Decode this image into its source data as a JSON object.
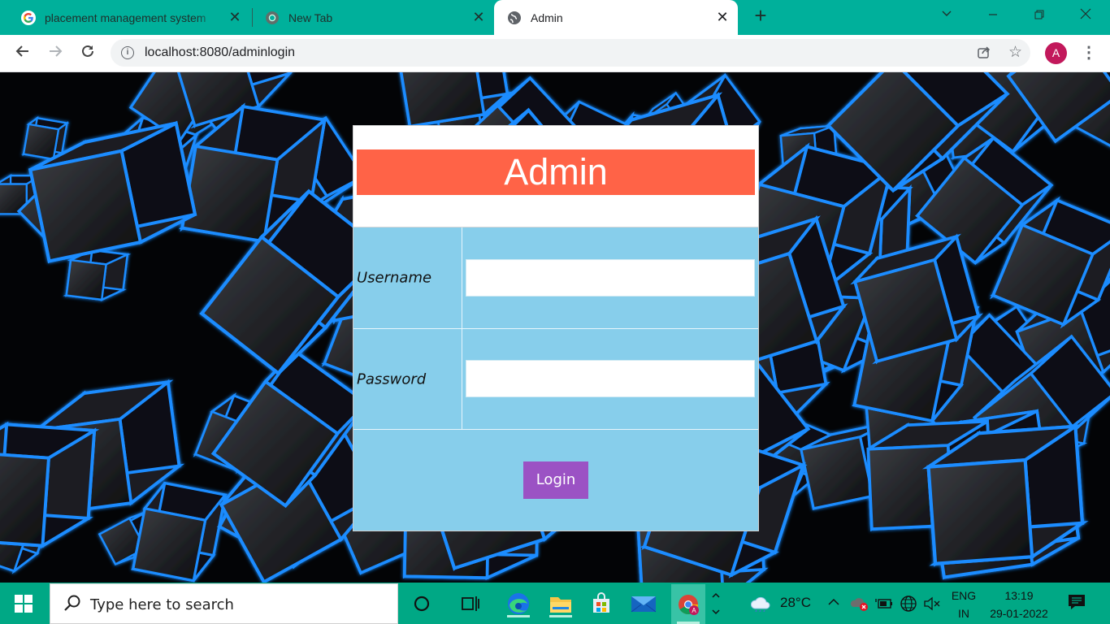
{
  "browser": {
    "tabs": [
      {
        "title": "placement management system",
        "active": false,
        "favicon": "google-g-icon"
      },
      {
        "title": "New Tab",
        "active": false,
        "favicon": "chrome-icon"
      },
      {
        "title": "Admin",
        "active": true,
        "favicon": "globe-icon"
      }
    ],
    "url": "localhost:8080/adminlogin",
    "profile_initial": "A",
    "accent": "#00b09b"
  },
  "page": {
    "heading": "Admin",
    "username_label": "Username",
    "password_label": "Password",
    "username_value": "",
    "password_value": "",
    "login_label": "Login",
    "colors": {
      "heading_bg": "#ff6347",
      "form_bg": "#87ceeb",
      "button_bg": "#9b52c4"
    }
  },
  "taskbar": {
    "search_placeholder": "Type here to search",
    "weather": "28°C",
    "language": "ENG",
    "region": "IN",
    "time": "13:19",
    "date": "29-01-2022",
    "pinned_apps": [
      "cortana-icon",
      "task-view-icon",
      "edge-icon",
      "file-explorer-icon",
      "microsoft-store-icon",
      "mail-icon",
      "chrome-icon"
    ]
  }
}
